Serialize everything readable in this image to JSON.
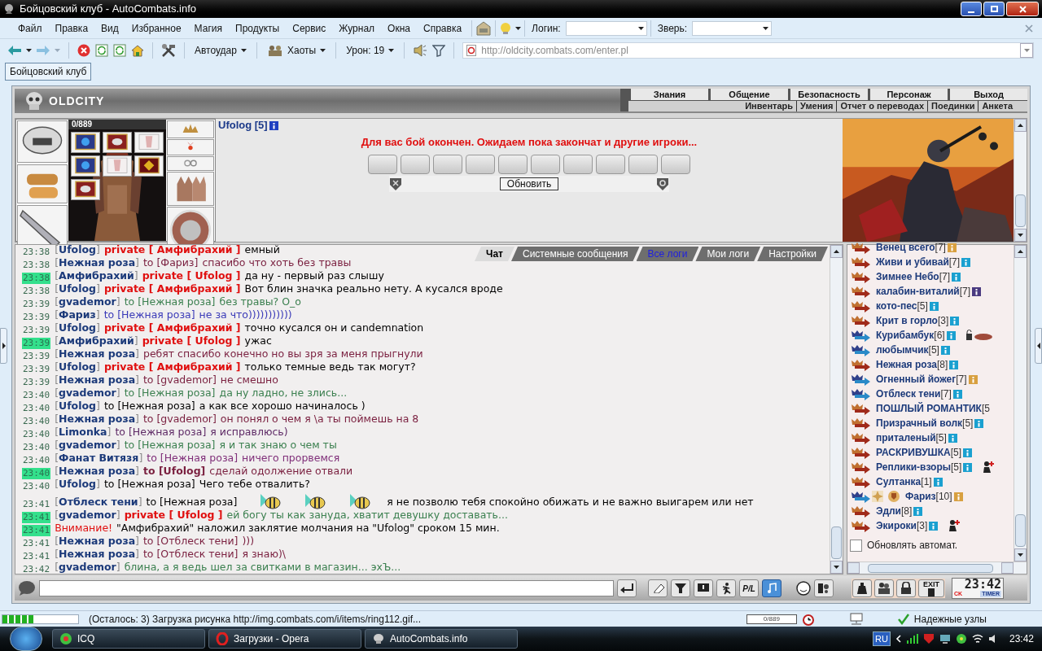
{
  "window": {
    "title": "Бойцовский клуб - AutoCombats.info"
  },
  "menu": [
    "Файл",
    "Правка",
    "Вид",
    "Избранное",
    "Магия",
    "Продукты",
    "Сервис",
    "Журнал",
    "Окна",
    "Справка"
  ],
  "login": {
    "label": "Логин:"
  },
  "pet": {
    "label": "Зверь:"
  },
  "toolbar": {
    "autohit": "Автоудар",
    "chaos": "Хаоты",
    "damage": "Урон: 19",
    "address": "http://oldcity.combats.com/enter.pl"
  },
  "tabs": [
    {
      "label": "Бойцовский клуб",
      "selected": true
    }
  ],
  "game": {
    "logo": "OLDCITY",
    "nav": [
      "Знания",
      "Общение",
      "Безопасность",
      "Персонаж",
      "Выход"
    ],
    "subnav": [
      "Инвентарь",
      "Умения",
      "Отчет о переводах",
      "Поединки",
      "Анкета"
    ],
    "hp": "0/889",
    "player": "Ufolog [5]",
    "battle_message": "Для вас бой окончен. Ожидаем пока закончат и другие игроки...",
    "refresh_button": "Обновить"
  },
  "chat_tabs": [
    {
      "label": "Чат",
      "selected": true,
      "highlighted": false
    },
    {
      "label": "Системные сообщения",
      "selected": false,
      "highlighted": false
    },
    {
      "label": "Все логи",
      "selected": false,
      "highlighted": true
    },
    {
      "label": "Мои логи",
      "selected": false,
      "highlighted": false
    },
    {
      "label": "Настройки",
      "selected": false,
      "highlighted": false
    }
  ],
  "messages": [
    {
      "time": "23:38",
      "highlight": false,
      "sender": "[**Ufolog**]",
      "kind": "private",
      "addressee": "private [ Амфибрахий ]",
      "text": "емный",
      "color": "#000000"
    },
    {
      "time": "23:38",
      "highlight": false,
      "sender": "[**Нежная роза**]",
      "kind": "to",
      "addressee": "to [Фариз]",
      "text": "спасибо что хоть без травы",
      "color": "#7a1f3f"
    },
    {
      "time": "23:38",
      "highlight": true,
      "sender": "[**Амфибрахий**]",
      "kind": "private",
      "addressee": "private [ Ufolog ]",
      "text": "да ну - первый раз слышу",
      "color": "#000000"
    },
    {
      "time": "23:38",
      "highlight": false,
      "sender": "[**Ufolog**]",
      "kind": "private",
      "addressee": "private [ Амфибрахий ]",
      "text": "Вот блин значка реально нету. А кусался вроде",
      "color": "#000000"
    },
    {
      "time": "23:39",
      "highlight": false,
      "sender": "[**gvademor**]",
      "kind": "to",
      "addressee": "to [Нежная роза]",
      "text": "без травы? О_о",
      "color": "#3c8050"
    },
    {
      "time": "23:39",
      "highlight": false,
      "sender": "[**Фариз**]",
      "kind": "to",
      "addressee": "to [Нежная роза]",
      "text": "не за что)))))))))))",
      "color": "#3a3ab8"
    },
    {
      "time": "23:39",
      "highlight": false,
      "sender": "[**Ufolog**]",
      "kind": "private",
      "addressee": "private [ Амфибрахий ]",
      "text": "точно кусался он и candemnation",
      "color": "#000000"
    },
    {
      "time": "23:39",
      "highlight": true,
      "sender": "[**Амфибрахий**]",
      "kind": "private",
      "addressee": "private [ Ufolog ]",
      "text": "ужас",
      "color": "#000000"
    },
    {
      "time": "23:39",
      "highlight": false,
      "sender": "[**Нежная роза**]",
      "kind": "all",
      "text": "ребят спасибо конечно но вы зря за меня прыгнули",
      "color": "#7a1f3f"
    },
    {
      "time": "23:39",
      "highlight": false,
      "sender": "[**Ufolog**]",
      "kind": "private",
      "addressee": "private [ Амфибрахий ]",
      "text": "только темные ведь так могут?",
      "color": "#000000"
    },
    {
      "time": "23:39",
      "highlight": false,
      "sender": "[**Нежная роза**]",
      "kind": "to",
      "addressee": "to [gvademor]",
      "text": "не смешно",
      "color": "#7a1f3f"
    },
    {
      "time": "23:40",
      "highlight": false,
      "sender": "[**gvademor**]",
      "kind": "to",
      "addressee": "to [Нежная роза]",
      "text": "да ну ладно, не злись...",
      "color": "#3c8050"
    },
    {
      "time": "23:40",
      "highlight": false,
      "sender": "[**Ufolog**]",
      "kind": "to",
      "addressee": "to [Нежная роза]",
      "text": "а как все хорошо начиналось )",
      "color": "#000000"
    },
    {
      "time": "23:40",
      "highlight": false,
      "sender": "[**Нежная роза**]",
      "kind": "to",
      "addressee": "to [gvademor]",
      "text": "он понял о чем я \\а ты поймешь на 8",
      "color": "#7a1f3f"
    },
    {
      "time": "23:40",
      "highlight": false,
      "sender": "[**Limonka**]",
      "kind": "to",
      "addressee": "to [Нежная роза]",
      "text": "я исправлюсь)",
      "color": "#5e2a66"
    },
    {
      "time": "23:40",
      "highlight": false,
      "sender": "[**gvademor**]",
      "kind": "to",
      "addressee": "to [Нежная роза]",
      "text": "я и так знаю о чем ты",
      "color": "#3c8050"
    },
    {
      "time": "23:40",
      "highlight": false,
      "sender": "[**Фанат Витязя**]",
      "kind": "to",
      "addressee": "to [Нежная роза]",
      "text": "ничего прорвемся",
      "color": "#80307a"
    },
    {
      "time": "23:40",
      "highlight": true,
      "sender": "[**Нежная роза**]",
      "kind": "to_me",
      "addressee": "to [Ufolog]",
      "text": "сделай одолжение отвали",
      "color": "#7a1f3f"
    },
    {
      "time": "23:40",
      "highlight": false,
      "sender": "[**Ufolog**]",
      "kind": "to",
      "addressee": "to [Нежная роза]",
      "text": "Чего тебе отвалить?",
      "color": "#000000"
    },
    {
      "time": "23:41",
      "highlight": false,
      "sender": "[**Отблеск тени**]",
      "kind": "to",
      "addressee": "to [Нежная роза]",
      "smileys": [
        {
          "kind": "bee"
        },
        {
          "kind": "bee"
        },
        {
          "kind": "bee"
        }
      ],
      "text": "я не позволю тебя спокойно обижать и не важно выигарем или нет",
      "color": "#000000"
    },
    {
      "time": "23:41",
      "highlight": true,
      "sender": "[**gvademor**]",
      "kind": "private",
      "addressee": "private [ Ufolog ]",
      "text": "ей богу ты как зануда, хватит девушку доставать...",
      "color": "#3c8050"
    },
    {
      "time": "23:41",
      "highlight": true,
      "sender": "Внимание!",
      "kind": "system",
      "text": "\"Амфибрахий\" наложил заклятие молчания на \"Ufolog\" сроком 15 мин.",
      "color": "#000000"
    },
    {
      "time": "23:41",
      "highlight": false,
      "sender": "[**Нежная роза**]",
      "kind": "to",
      "addressee": "to [Отблеск тени]",
      "text": ")))",
      "color": "#7a1f3f"
    },
    {
      "time": "23:41",
      "highlight": false,
      "sender": "[**Нежная роза**]",
      "kind": "to",
      "addressee": "to [Отблеск тени]",
      "text": "я знаю)\\",
      "color": "#7a1f3f"
    },
    {
      "time": "23:42",
      "highlight": false,
      "sender": "[**gvademor**]",
      "kind": "all",
      "text": "блина, а я ведь шел за свитками в магазин... эхЪ...",
      "color": "#3c8050"
    }
  ],
  "users": [
    {
      "kind": "red_arrow",
      "name": "Венец всего",
      "level": "[7]",
      "color": "#d8a040"
    },
    {
      "kind": "red_arrow",
      "name": "Живи и убивай",
      "level": "[7]",
      "color": "#1aa0d0"
    },
    {
      "kind": "red_arrow",
      "name": "Зимнее Небо",
      "level": "[7]",
      "color": "#1aa0d0"
    },
    {
      "kind": "red_arrow",
      "name": "калабин-виталий",
      "level": "[7]",
      "color": "#4a3a80"
    },
    {
      "kind": "red_arrow",
      "name": "кото-пес",
      "level": "[5]",
      "color": "#1aa0d0"
    },
    {
      "kind": "red_arrow",
      "name": "Крит в горло",
      "level": "[3]",
      "color": "#1aa0d0"
    },
    {
      "kind": "blue_arrow",
      "name": "Курибамбук",
      "level": "[6]",
      "color": "#1aa0d0",
      "badges": [
        {
          "kind": "lock"
        }
      ]
    },
    {
      "kind": "blue_arrow",
      "name": "любымчик",
      "level": "[5]",
      "color": "#1aa0d0"
    },
    {
      "kind": "red_arrow",
      "name": "Нежная роза",
      "level": "[8]",
      "color": "#1aa0d0"
    },
    {
      "kind": "blue_arrow",
      "name": "Огненный йожег",
      "level": "[7]",
      "color": "#d8a040"
    },
    {
      "kind": "blue_arrow",
      "name": "Отблеск тени",
      "level": "[7]",
      "color": "#1aa0d0"
    },
    {
      "kind": "red_arrow",
      "name": "ПОШЛЫЙ РОМАНТИК",
      "level": "[5"
    },
    {
      "kind": "red_arrow",
      "name": "Призрачный волк",
      "level": "[5]",
      "color": "#1aa0d0"
    },
    {
      "kind": "red_arrow",
      "name": "приталеный",
      "level": "[5]",
      "color": "#1aa0d0"
    },
    {
      "kind": "red_arrow",
      "name": "РАСКРИВУШКА",
      "level": "[5]",
      "color": "#1aa0d0"
    },
    {
      "kind": "red_arrow",
      "name": "Реплики-взоры",
      "level": "[5]",
      "color": "#1aa0d0",
      "badges": [
        {
          "kind": "person_add"
        }
      ]
    },
    {
      "kind": "red_arrow",
      "name": "Султанка",
      "level": "[1]",
      "color": "#1aa0d0"
    },
    {
      "kind": "blue_arrow",
      "name": "Фариз",
      "level": "[10]",
      "color": "#d8a040",
      "badges": [
        {
          "kind": "sparkle"
        },
        {
          "kind": "shield"
        }
      ]
    },
    {
      "kind": "red_arrow",
      "name": "Эдли",
      "level": "[8]",
      "color": "#1aa0d0"
    },
    {
      "kind": "red_arrow",
      "name": "Экироки",
      "level": "[3]",
      "color": "#1aa0d0",
      "badges": [
        {
          "kind": "person_add"
        }
      ]
    }
  ],
  "auto_refresh": {
    "label": "Обновлять автомат.",
    "checked": false
  },
  "chat_toolbar": {
    "pl_label": "P/L",
    "exit_label": "EXIT"
  },
  "clock": {
    "time": "23:42",
    "badge": "CK",
    "label": "TIMER"
  },
  "status": {
    "level": 0.42,
    "text": "(Осталось: 3) Загрузка рисунка http://img.combats.com/i/items/ring112.gif...",
    "counter": "0/889",
    "security": "Надежные узлы"
  },
  "taskbar": {
    "items": [
      {
        "label": "ICQ",
        "kind": "icq"
      },
      {
        "label": "Загрузки - Opera",
        "kind": "opera"
      },
      {
        "label": "AutoCombats.info",
        "kind": "app"
      }
    ],
    "language": "RU",
    "time": "23:42"
  }
}
